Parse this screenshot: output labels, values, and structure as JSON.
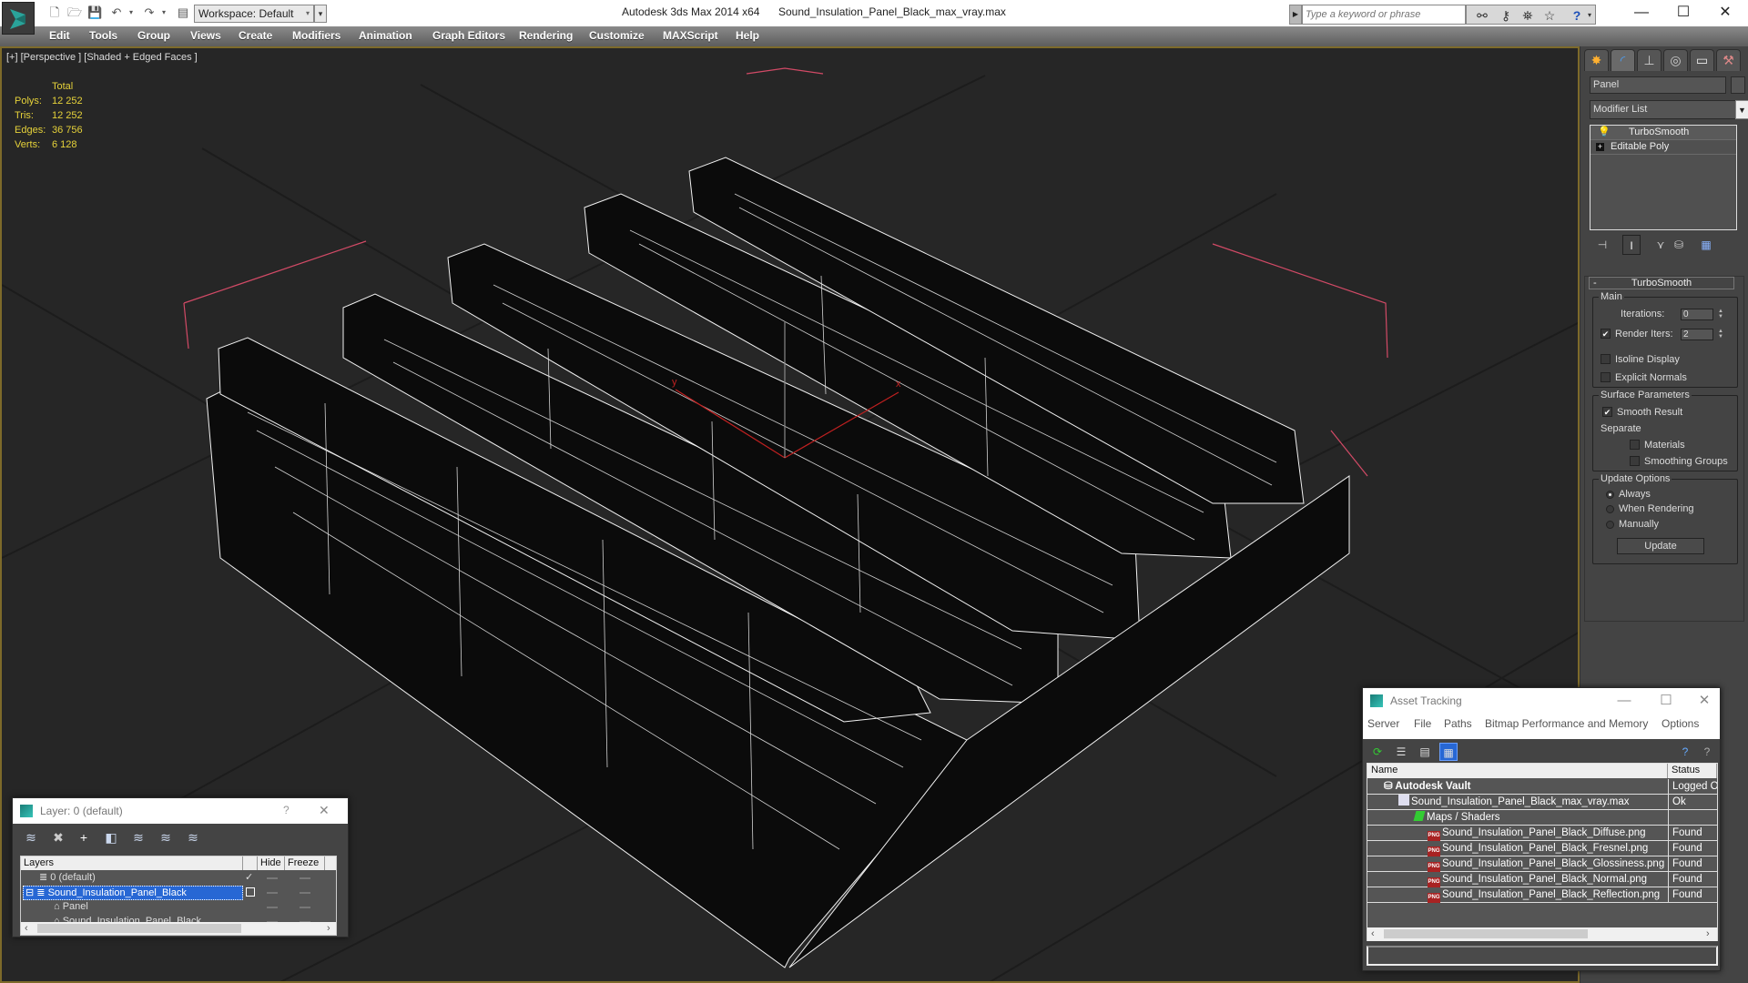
{
  "titlebar": {
    "app_title": "Autodesk 3ds Max  2014 x64",
    "file_title": "Sound_Insulation_Panel_Black_max_vray.max",
    "workspace_label": "Workspace: Default",
    "search_placeholder": "Type a keyword or phrase",
    "quick_access": [
      "new-file-icon",
      "open-file-icon",
      "save-icon",
      "undo-icon",
      "redo-icon",
      "project-folder-icon"
    ],
    "search_tools": [
      "binoculars-icon",
      "key-icon",
      "satellite-icon",
      "star-icon",
      "help-icon"
    ],
    "window_buttons": {
      "minimize": "—",
      "maximize": "☐",
      "close": "✕"
    }
  },
  "menubar": {
    "items": [
      "Edit",
      "Tools",
      "Group",
      "Views",
      "Create",
      "Modifiers",
      "Animation",
      "Graph Editors",
      "Rendering",
      "Customize",
      "MAXScript",
      "Help"
    ]
  },
  "viewport": {
    "label": "[+] [Perspective ] [Shaded + Edged Faces ]",
    "stats": {
      "header": "Total",
      "rows": [
        {
          "key": "Polys:",
          "value": "12 252"
        },
        {
          "key": "Tris:",
          "value": "12 252"
        },
        {
          "key": "Edges:",
          "value": "36 756"
        },
        {
          "key": "Verts:",
          "value": "6 128"
        }
      ]
    },
    "gizmo": {
      "x_label": "x",
      "y_label": "y"
    }
  },
  "command_panel": {
    "tabs": [
      "create-icon",
      "modify-icon",
      "hierarchy-icon",
      "motion-icon",
      "display-icon",
      "utilities-icon"
    ],
    "object_name": "Panel",
    "modifier_list_label": "Modifier List",
    "stack": [
      {
        "label": "TurboSmooth",
        "icon": "lightbulb-icon"
      },
      {
        "label": "Editable Poly",
        "icon": "expand-icon"
      }
    ],
    "turbosmooth": {
      "title": "TurboSmooth",
      "main_label": "Main",
      "iterations_label": "Iterations:",
      "iterations_value": "0",
      "render_iters_label": "Render Iters:",
      "render_iters_value": "2",
      "render_iters_checked": true,
      "isoline_label": "Isoline Display",
      "isoline_checked": false,
      "explicit_normals_label": "Explicit Normals",
      "explicit_normals_checked": false,
      "surface_label": "Surface Parameters",
      "smooth_result_label": "Smooth Result",
      "smooth_result_checked": true,
      "separate_label": "Separate",
      "materials_label": "Materials",
      "smoothing_groups_label": "Smoothing Groups",
      "update_options_label": "Update Options",
      "always_label": "Always",
      "when_rendering_label": "When Rendering",
      "manually_label": "Manually",
      "selected_update": "Always",
      "update_button": "Update"
    }
  },
  "layer_dialog": {
    "title": "Layer: 0 (default)",
    "help": "?",
    "close": "✕",
    "columns": [
      "Layers",
      "",
      "Hide",
      "Freeze"
    ],
    "rows": [
      {
        "name": "0 (default)",
        "type": "layer",
        "current": true
      },
      {
        "name": "Sound_Insulation_Panel_Black",
        "type": "layer",
        "selected": true,
        "expanded": true
      },
      {
        "name": "Panel",
        "type": "object"
      },
      {
        "name": "Sound_Insulation_Panel_Black",
        "type": "object"
      }
    ]
  },
  "asset_dialog": {
    "title": "Asset Tracking",
    "menu": [
      "Server",
      "File",
      "Paths",
      "Bitmap Performance and Memory",
      "Options"
    ],
    "columns": [
      "Name",
      "Status"
    ],
    "rows": [
      {
        "name": "Autodesk Vault",
        "status": "Logged O",
        "indent": 0,
        "icon": "vault-icon"
      },
      {
        "name": "Sound_Insulation_Panel_Black_max_vray.max",
        "status": "Ok",
        "indent": 1,
        "icon": "max-file-icon"
      },
      {
        "name": "Maps / Shaders",
        "status": "",
        "indent": 2,
        "icon": "maps-icon"
      },
      {
        "name": "Sound_Insulation_Panel_Black_Diffuse.png",
        "status": "Found",
        "indent": 3,
        "icon": "png-icon"
      },
      {
        "name": "Sound_Insulation_Panel_Black_Fresnel.png",
        "status": "Found",
        "indent": 3,
        "icon": "png-icon"
      },
      {
        "name": "Sound_Insulation_Panel_Black_Glossiness.png",
        "status": "Found",
        "indent": 3,
        "icon": "png-icon"
      },
      {
        "name": "Sound_Insulation_Panel_Black_Normal.png",
        "status": "Found",
        "indent": 3,
        "icon": "png-icon"
      },
      {
        "name": "Sound_Insulation_Panel_Black_Reflection.png",
        "status": "Found",
        "indent": 3,
        "icon": "png-icon"
      }
    ]
  },
  "colors": {
    "viewport_border": "#7d6a2a",
    "stats_text": "#e6d23a",
    "selection": "#2767d4",
    "gizmo": "#c02020"
  }
}
